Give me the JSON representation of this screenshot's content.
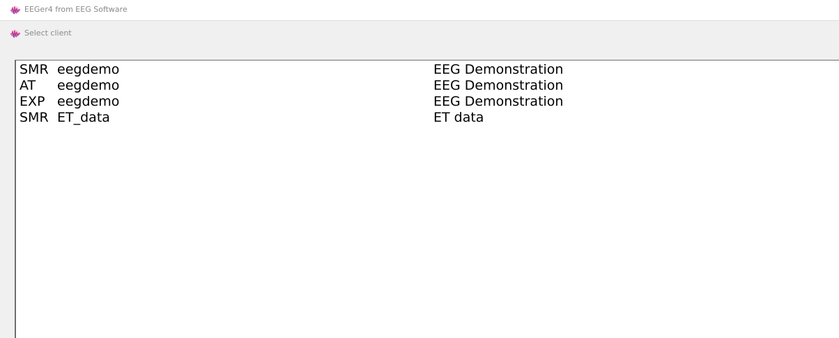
{
  "window": {
    "title": "EEGer4 from EEG Software",
    "icon": "eeger-logo-icon"
  },
  "dialog": {
    "title": "Select client",
    "icon": "eeger-logo-icon"
  },
  "client_list": {
    "rows": [
      {
        "code": "SMR",
        "client": "eegdemo",
        "description": "EEG Demonstration"
      },
      {
        "code": "AT",
        "client": "eegdemo",
        "description": "EEG Demonstration"
      },
      {
        "code": "EXP",
        "client": "eegdemo",
        "description": "EEG Demonstration"
      },
      {
        "code": "SMR",
        "client": "ET_data",
        "description": "ET data"
      }
    ]
  },
  "colors": {
    "icon_pink": "#d63a8a",
    "icon_purple": "#7b3fb0",
    "chrome_text": "#8a8a8a",
    "list_border": "#6e6e6e"
  }
}
